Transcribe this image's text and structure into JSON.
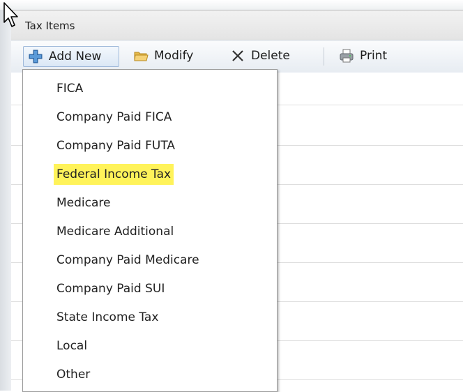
{
  "window": {
    "title": "Tax Items"
  },
  "toolbar": {
    "add_new_label": "Add New",
    "modify_label": "Modify",
    "delete_label": "Delete",
    "print_label": "Print"
  },
  "dropdown": {
    "items": [
      {
        "label": "FICA",
        "highlighted": false
      },
      {
        "label": "Company Paid FICA",
        "highlighted": false
      },
      {
        "label": "Company Paid FUTA",
        "highlighted": false
      },
      {
        "label": "Federal Income Tax",
        "highlighted": true
      },
      {
        "label": "Medicare",
        "highlighted": false
      },
      {
        "label": "Medicare Additional",
        "highlighted": false
      },
      {
        "label": "Company Paid Medicare",
        "highlighted": false
      },
      {
        "label": "Company Paid SUI",
        "highlighted": false
      },
      {
        "label": "State Income Tax",
        "highlighted": false
      },
      {
        "label": "Local",
        "highlighted": false
      },
      {
        "label": "Other",
        "highlighted": false
      }
    ],
    "highlight_color": "#fff35a"
  },
  "icons": {
    "add_new": "plus-icon",
    "modify": "folder-icon",
    "delete": "x-icon",
    "print": "printer-icon",
    "cursor": "mouse-cursor-icon"
  }
}
